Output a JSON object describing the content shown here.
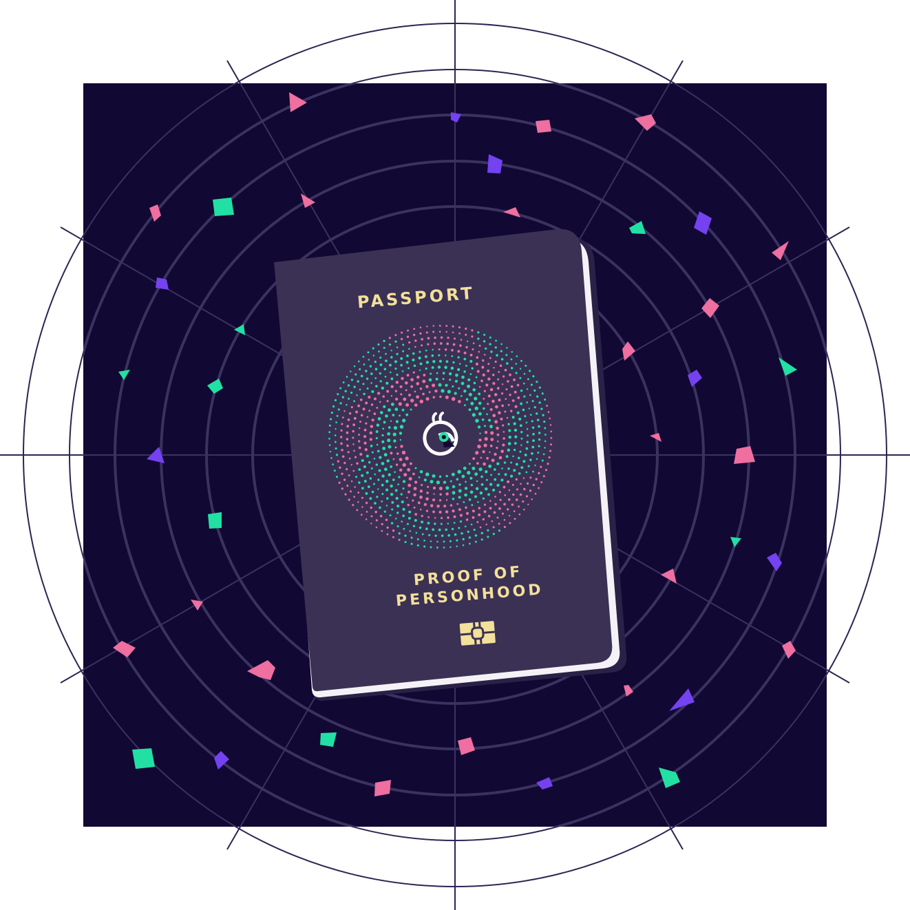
{
  "passport": {
    "title": "PASSPORT",
    "subtitle_line1": "PROOF OF",
    "subtitle_line2": "PERSONHOOD"
  },
  "colors": {
    "background_square": "#110833",
    "grid_lines": "#2b2452",
    "cover": "#3b3155",
    "cover_shadow": "#2a2147",
    "pages": "#f4f2f6",
    "text_gold": "#f3e09a",
    "accent_pink": "#ee6fa0",
    "accent_green": "#22e0a3",
    "accent_purple": "#7442f0"
  },
  "icons": [
    "gaia-logo-icon",
    "chip-icon"
  ]
}
